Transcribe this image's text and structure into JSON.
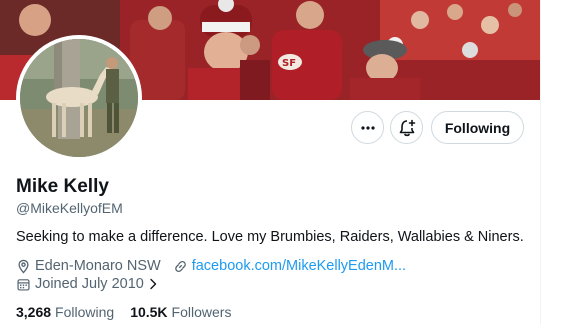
{
  "profile": {
    "display_name": "Mike Kelly",
    "handle": "@MikeKellyofEM",
    "bio": "Seeking to make a difference. Love my Brumbies, Raiders, Wallabies & Niners.",
    "location": "Eden-Monaro NSW",
    "website": "facebook.com/MikeKellyEdenM...",
    "joined": "Joined July 2010"
  },
  "actions": {
    "follow_label": "Following",
    "more_icon": "more-horizontal-icon",
    "notify_icon": "bell-plus-icon"
  },
  "stats": {
    "following_count": "3,268",
    "following_label": "Following",
    "followers_count": "10.5K",
    "followers_label": "Followers"
  },
  "colors": {
    "text_primary": "#0f1419",
    "text_secondary": "#536471",
    "link": "#1d9bf0",
    "border": "#cfd9de",
    "banner_red": "#a3262b"
  }
}
